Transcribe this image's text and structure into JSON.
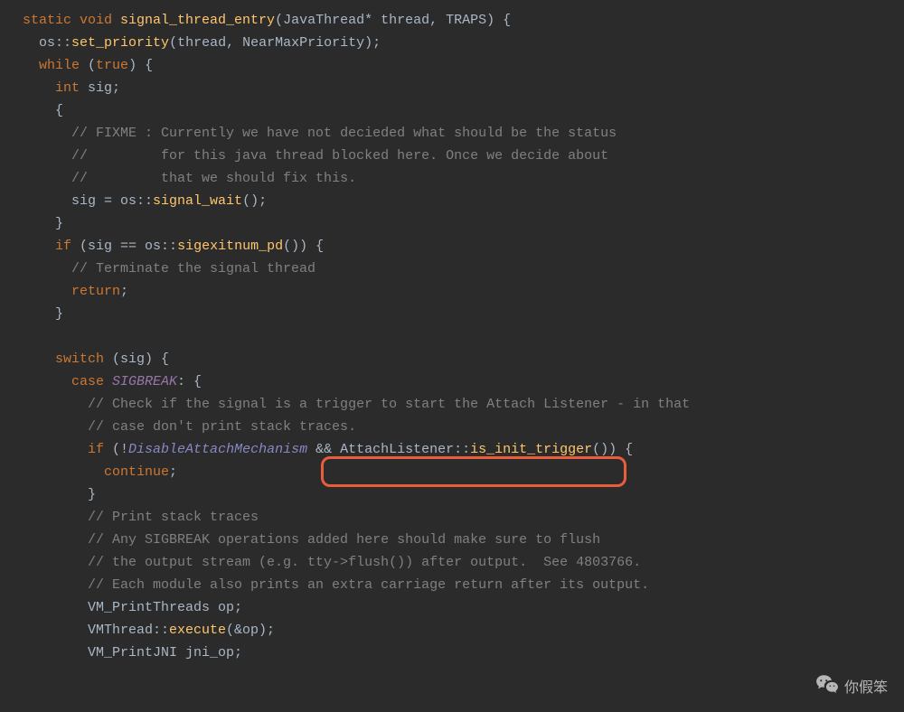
{
  "code": {
    "lines": [
      {
        "indent": 0,
        "tokens": [
          {
            "t": "static ",
            "c": "keyword"
          },
          {
            "t": "void ",
            "c": "keyword"
          },
          {
            "t": "signal_thread_entry",
            "c": "func"
          },
          {
            "t": "(JavaThread* thread, TRAPS) {",
            "c": "default"
          }
        ]
      },
      {
        "indent": 1,
        "tokens": [
          {
            "t": "os::",
            "c": "default"
          },
          {
            "t": "set_priority",
            "c": "func"
          },
          {
            "t": "(thread, NearMaxPriority);",
            "c": "default"
          }
        ]
      },
      {
        "indent": 1,
        "tokens": [
          {
            "t": "while ",
            "c": "keyword"
          },
          {
            "t": "(",
            "c": "default"
          },
          {
            "t": "true",
            "c": "keyword"
          },
          {
            "t": ") {",
            "c": "default"
          }
        ]
      },
      {
        "indent": 2,
        "tokens": [
          {
            "t": "int ",
            "c": "keyword"
          },
          {
            "t": "sig;",
            "c": "default"
          }
        ]
      },
      {
        "indent": 2,
        "tokens": [
          {
            "t": "{",
            "c": "default"
          }
        ]
      },
      {
        "indent": 3,
        "tokens": [
          {
            "t": "// FIXME : Currently we have not decieded what should be the status",
            "c": "comment"
          }
        ]
      },
      {
        "indent": 3,
        "tokens": [
          {
            "t": "//         for this java thread blocked here. Once we decide about",
            "c": "comment"
          }
        ]
      },
      {
        "indent": 3,
        "tokens": [
          {
            "t": "//         that we should fix this.",
            "c": "comment"
          }
        ]
      },
      {
        "indent": 3,
        "tokens": [
          {
            "t": "sig = os::",
            "c": "default"
          },
          {
            "t": "signal_wait",
            "c": "func"
          },
          {
            "t": "();",
            "c": "default"
          }
        ]
      },
      {
        "indent": 2,
        "tokens": [
          {
            "t": "}",
            "c": "default"
          }
        ]
      },
      {
        "indent": 2,
        "tokens": [
          {
            "t": "if ",
            "c": "keyword"
          },
          {
            "t": "(sig == os::",
            "c": "default"
          },
          {
            "t": "sigexitnum_pd",
            "c": "func"
          },
          {
            "t": "()) {",
            "c": "default"
          }
        ]
      },
      {
        "indent": 3,
        "tokens": [
          {
            "t": "// Terminate the signal thread",
            "c": "comment"
          }
        ]
      },
      {
        "indent": 3,
        "tokens": [
          {
            "t": "return",
            "c": "keyword"
          },
          {
            "t": ";",
            "c": "default"
          }
        ]
      },
      {
        "indent": 2,
        "tokens": [
          {
            "t": "}",
            "c": "default"
          }
        ]
      },
      {
        "indent": 0,
        "tokens": [
          {
            "t": "",
            "c": "default"
          }
        ]
      },
      {
        "indent": 2,
        "tokens": [
          {
            "t": "switch ",
            "c": "keyword"
          },
          {
            "t": "(sig) {",
            "c": "default"
          }
        ]
      },
      {
        "indent": 3,
        "tokens": [
          {
            "t": "case ",
            "c": "keyword"
          },
          {
            "t": "SIGBREAK",
            "c": "const",
            "italic": true
          },
          {
            "t": ": {",
            "c": "default"
          }
        ]
      },
      {
        "indent": 4,
        "tokens": [
          {
            "t": "// Check if the signal is a trigger to start the Attach Listener - in that",
            "c": "comment"
          }
        ]
      },
      {
        "indent": 4,
        "tokens": [
          {
            "t": "// case don't print stack traces.",
            "c": "comment"
          }
        ]
      },
      {
        "indent": 4,
        "tokens": [
          {
            "t": "if ",
            "c": "keyword"
          },
          {
            "t": "(!",
            "c": "default"
          },
          {
            "t": "DisableAttachMechanism",
            "c": "class",
            "italic": true
          },
          {
            "t": " && ",
            "c": "default"
          },
          {
            "t": "AttachListener::",
            "c": "default"
          },
          {
            "t": "is_init_trigger",
            "c": "func"
          },
          {
            "t": "()) {",
            "c": "default"
          }
        ]
      },
      {
        "indent": 5,
        "tokens": [
          {
            "t": "continue",
            "c": "keyword"
          },
          {
            "t": ";",
            "c": "default"
          }
        ]
      },
      {
        "indent": 4,
        "tokens": [
          {
            "t": "}",
            "c": "default"
          }
        ]
      },
      {
        "indent": 4,
        "tokens": [
          {
            "t": "// Print stack traces",
            "c": "comment"
          }
        ]
      },
      {
        "indent": 4,
        "tokens": [
          {
            "t": "// Any SIGBREAK operations added here should make sure to flush",
            "c": "comment"
          }
        ]
      },
      {
        "indent": 4,
        "tokens": [
          {
            "t": "// the output stream (e.g. tty->flush()) after output.  See 4803766.",
            "c": "comment"
          }
        ]
      },
      {
        "indent": 4,
        "tokens": [
          {
            "t": "// Each module also prints an extra carriage return after its output.",
            "c": "comment"
          }
        ]
      },
      {
        "indent": 4,
        "tokens": [
          {
            "t": "VM_PrintThreads op;",
            "c": "default"
          }
        ]
      },
      {
        "indent": 4,
        "tokens": [
          {
            "t": "VMThread::",
            "c": "default"
          },
          {
            "t": "execute",
            "c": "func"
          },
          {
            "t": "(&op);",
            "c": "default"
          }
        ]
      },
      {
        "indent": 4,
        "tokens": [
          {
            "t": "VM_PrintJNI jni_op;",
            "c": "default"
          }
        ]
      }
    ],
    "indent_unit": "  "
  },
  "highlight": {
    "text": "AttachListener::is_init_trigger()"
  },
  "watermark": {
    "text": "你假笨"
  }
}
